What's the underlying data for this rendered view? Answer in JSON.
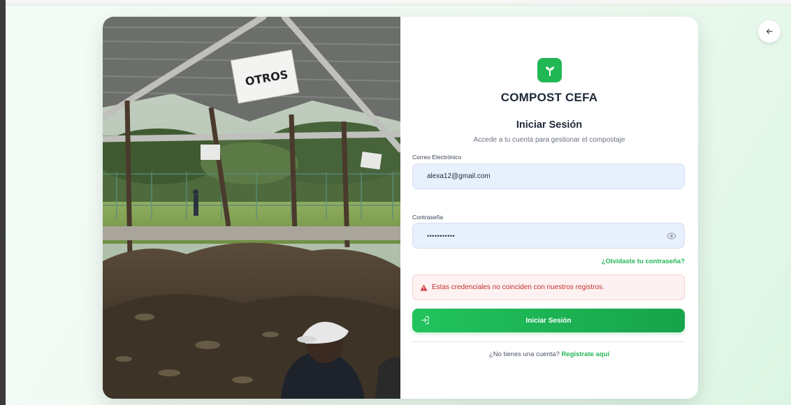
{
  "brand": {
    "name": "COMPOST CEFA"
  },
  "photo": {
    "sign_text": "OTROS"
  },
  "login": {
    "title": "Iniciar Sesión",
    "subtitle": "Accede a tu cuenta para gestionar el compostaje",
    "email_label": "Correo Electrónico",
    "email_value": "alexa12@gmail.com",
    "password_label": "Contraseña",
    "password_value": "•••••••••••",
    "forgot_link": "¿Olvidaste tu contraseña?",
    "error_message": "Estas credenciales no coinciden con nuestros registros.",
    "submit_label": "Iniciar Sesión",
    "register_prompt": "¿No tienes una cuenta?",
    "register_link": "Regístrate aquí"
  },
  "icons": {
    "back": "arrow-left-icon",
    "logo": "sprout-icon",
    "eye": "eye-icon",
    "warning": "warning-triangle-icon",
    "login": "login-enter-icon"
  },
  "colors": {
    "accent": "#22b755",
    "error": "#c53030",
    "input_bg": "#e8f0fe"
  }
}
